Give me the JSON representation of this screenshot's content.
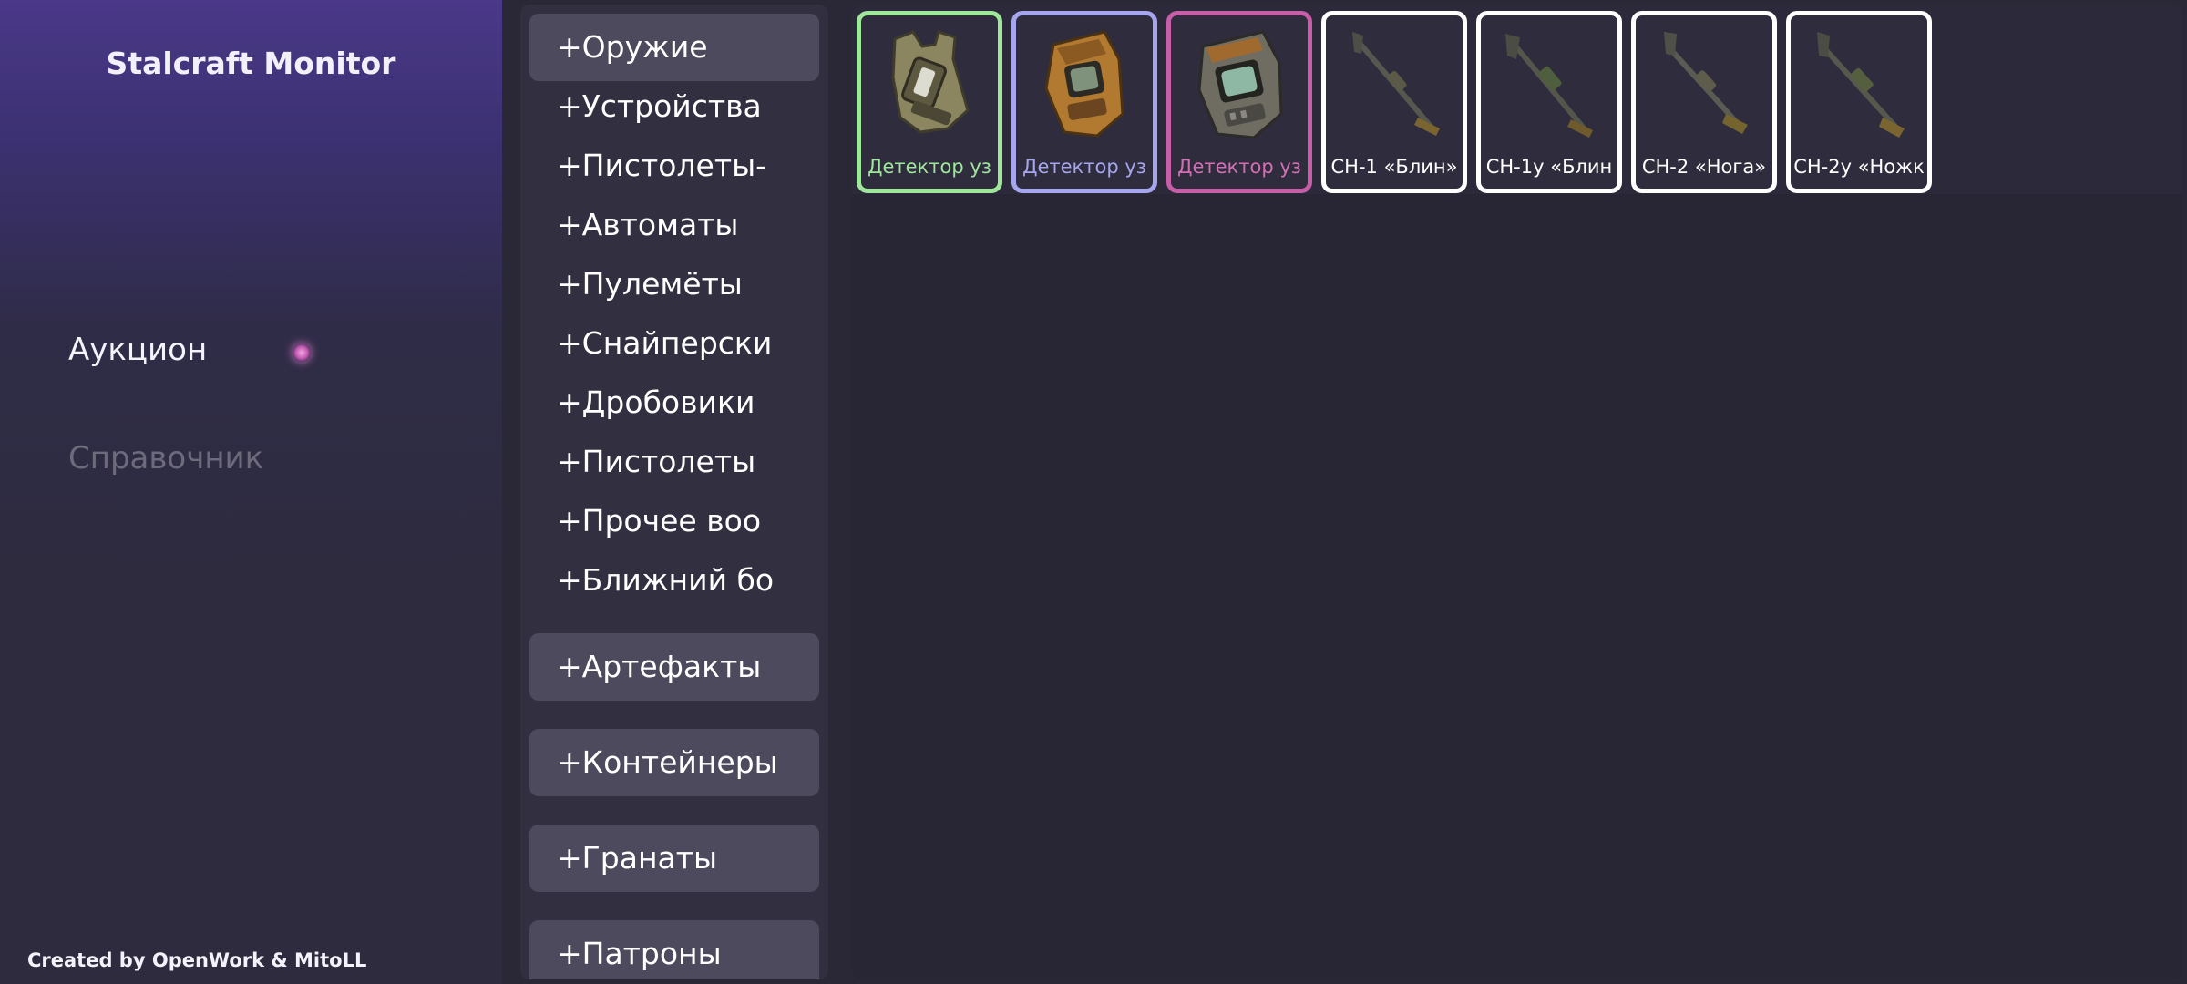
{
  "app": {
    "title": "Stalcraft Monitor",
    "credits": "Created by OpenWork & MitoLL"
  },
  "nav": {
    "auction": "Аукцион",
    "reference": "Справочник"
  },
  "categories": [
    {
      "label": "+Оружие",
      "boxed": true
    },
    {
      "label": "+Устройства",
      "boxed": false
    },
    {
      "label": "+Пистолеты-",
      "boxed": false
    },
    {
      "label": "+Автоматы",
      "boxed": false
    },
    {
      "label": "+Пулемёты",
      "boxed": false
    },
    {
      "label": "+Снайперски",
      "boxed": false
    },
    {
      "label": "+Дробовики",
      "boxed": false
    },
    {
      "label": "+Пистолеты",
      "boxed": false
    },
    {
      "label": "+Прочее воо",
      "boxed": false
    },
    {
      "label": "+Ближний бо",
      "boxed": false
    },
    {
      "label": "+Артефакты",
      "boxed": true
    },
    {
      "label": "+Контейнеры",
      "boxed": true
    },
    {
      "label": "+Гранаты",
      "boxed": true
    },
    {
      "label": "+Патроны",
      "boxed": true
    }
  ],
  "items": [
    {
      "name": "Детектор уз",
      "icon": "detector-icon",
      "rarity_color": "#9fe79b",
      "text_color": "#9fe79b"
    },
    {
      "name": "Детектор уз",
      "icon": "detector-icon",
      "rarity_color": "#a6a6ee",
      "text_color": "#a6a6ee"
    },
    {
      "name": "Детектор уз",
      "icon": "detector-icon",
      "rarity_color": "#c75ea8",
      "text_color": "#d46fb5"
    },
    {
      "name": "СН-1 «Блин»",
      "icon": "metal-detector-icon",
      "rarity_color": "#ffffff",
      "text_color": "#ffffff"
    },
    {
      "name": "СН-1у «Блин",
      "icon": "metal-detector-icon",
      "rarity_color": "#ffffff",
      "text_color": "#ffffff"
    },
    {
      "name": "СН-2 «Нога»",
      "icon": "metal-detector-icon",
      "rarity_color": "#ffffff",
      "text_color": "#ffffff"
    },
    {
      "name": "СН-2у «Ножк",
      "icon": "metal-detector-icon",
      "rarity_color": "#ffffff",
      "text_color": "#ffffff"
    }
  ],
  "colors": {
    "accent": "#4a3888",
    "nav_dot": "#d07bc4"
  }
}
